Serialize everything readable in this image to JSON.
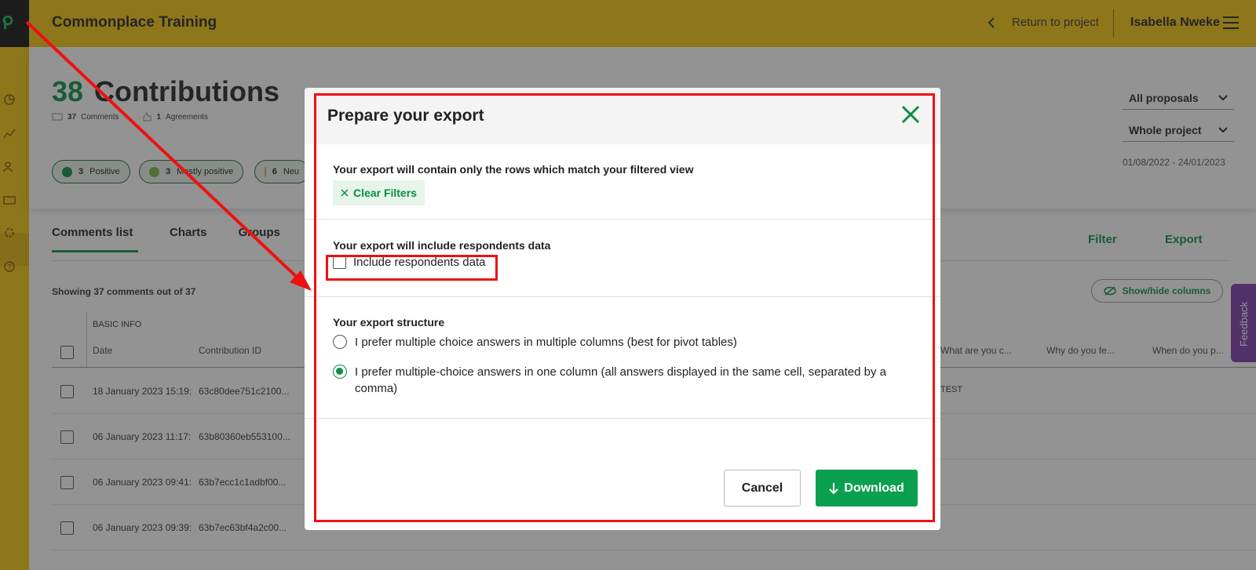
{
  "header": {
    "app_title": "Commonplace Training",
    "return_label": "Return to project",
    "user_name": "Isabella Nweke"
  },
  "hero": {
    "count": "38",
    "title": "Contributions",
    "comments_count": "37",
    "comments_label": "Comments",
    "agreements_count": "1",
    "agreements_label": "Agreements",
    "chips": [
      {
        "count": "3",
        "label": "Positive",
        "color": "#0a8f44"
      },
      {
        "count": "3",
        "label": "Mostly positive",
        "color": "#7cb342"
      },
      {
        "count": "6",
        "label": "Neu",
        "color": "#f0a500"
      }
    ],
    "proposals_select": "All proposals",
    "period_select": "Whole project",
    "date_range": "01/08/2022 - 24/01/2023"
  },
  "tabs": [
    "Comments list",
    "Charts",
    "Groups"
  ],
  "toolbar": {
    "filter": "Filter",
    "export": "Export",
    "showhide": "Show/hide columns"
  },
  "table": {
    "showing": "Showing 37 comments out of 37",
    "group_label": "BASIC INFO",
    "headers": [
      "Date",
      "Contribution ID",
      "What are you c...",
      "Why do you fe...",
      "When do you p..."
    ],
    "rows": [
      {
        "date": "18 January 2023 15:19:",
        "id": "63c80dee751c2100..."
      },
      {
        "date": "06 January 2023 11:17:",
        "id": "63b80360eb553100..."
      },
      {
        "date": "06 January 2023 09:41:",
        "id": "63b7ecc1c1adbf00..."
      },
      {
        "date": "06 January 2023 09:39:",
        "id": "63b7ec63bf4a2c00..."
      }
    ],
    "test_value": "TEST"
  },
  "feedback": "Feedback",
  "modal": {
    "title": "Prepare your export",
    "filtered_heading": "Your export will contain only the rows which match your filtered view",
    "clear_filters": "Clear Filters",
    "respondents_heading": "Your export will include respondents data",
    "respondents_checkbox": "Include respondents data",
    "respondents_checked": false,
    "structure_heading": "Your export structure",
    "option_multi_columns": "I prefer multiple choice answers in multiple columns (best for pivot tables)",
    "option_one_column": "I prefer multiple-choice answers in one column (all answers displayed in the same cell, separated by a comma)",
    "selected_option": "one_column",
    "cancel": "Cancel",
    "download": "Download"
  },
  "colors": {
    "brand_yellow": "#f5c40f",
    "accent_green": "#0a8f44",
    "annotation_red": "#e11111",
    "feedback_purple": "#7c3aa8"
  }
}
